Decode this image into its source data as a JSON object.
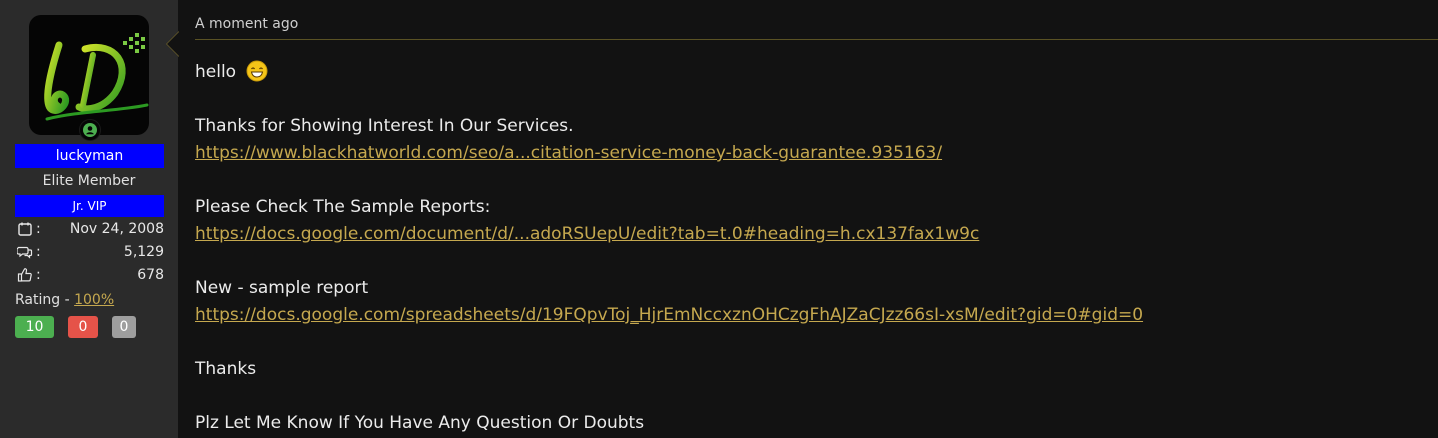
{
  "user": {
    "username": "luckyman",
    "title": "Elite Member",
    "badge": "Jr. VIP",
    "stats": {
      "joined": "Nov 24, 2008",
      "messages": "5,129",
      "reactions": "678"
    },
    "stat_labels": {
      "joined": ":",
      "messages": ":",
      "reactions": ":"
    },
    "rating_label": "Rating - ",
    "rating_value": "100%",
    "ratings": {
      "positive": "10",
      "negative": "0",
      "neutral": "0"
    },
    "avatar_letters": "LD"
  },
  "post": {
    "timestamp": "A moment ago",
    "greeting": "hello",
    "line_thanks_interest": "Thanks for Showing Interest In Our Services.",
    "link_service": "https://www.blackhatworld.com/seo/a...citation-service-money-back-guarantee.935163/",
    "line_check_reports": "Please Check The Sample Reports:",
    "link_docs": "https://docs.google.com/document/d/...adoRSUepU/edit?tab=t.0#heading=h.cx137fax1w9c",
    "line_new_sample": "New - sample report",
    "link_sheet": "https://docs.google.com/spreadsheets/d/19FQpvToj_HjrEmNccxznOHCzgFhAJZaCJzz66sI-xsM/edit?gid=0#gid=0",
    "line_thanks": "Thanks",
    "line_questions": "Plz Let Me Know If You Have Any Question Or Doubts"
  },
  "icons": {
    "online": "user-online-icon",
    "joined": "calendar-icon",
    "messages": "messages-icon",
    "reactions": "thumbs-up-icon",
    "emoji": "grinning-face-icon"
  },
  "colors": {
    "username_bg": "#0000ff",
    "link": "#c5a84f",
    "positive": "#4caf50",
    "negative": "#e55349",
    "neutral": "#9e9e9e",
    "online": "#4caf50"
  }
}
